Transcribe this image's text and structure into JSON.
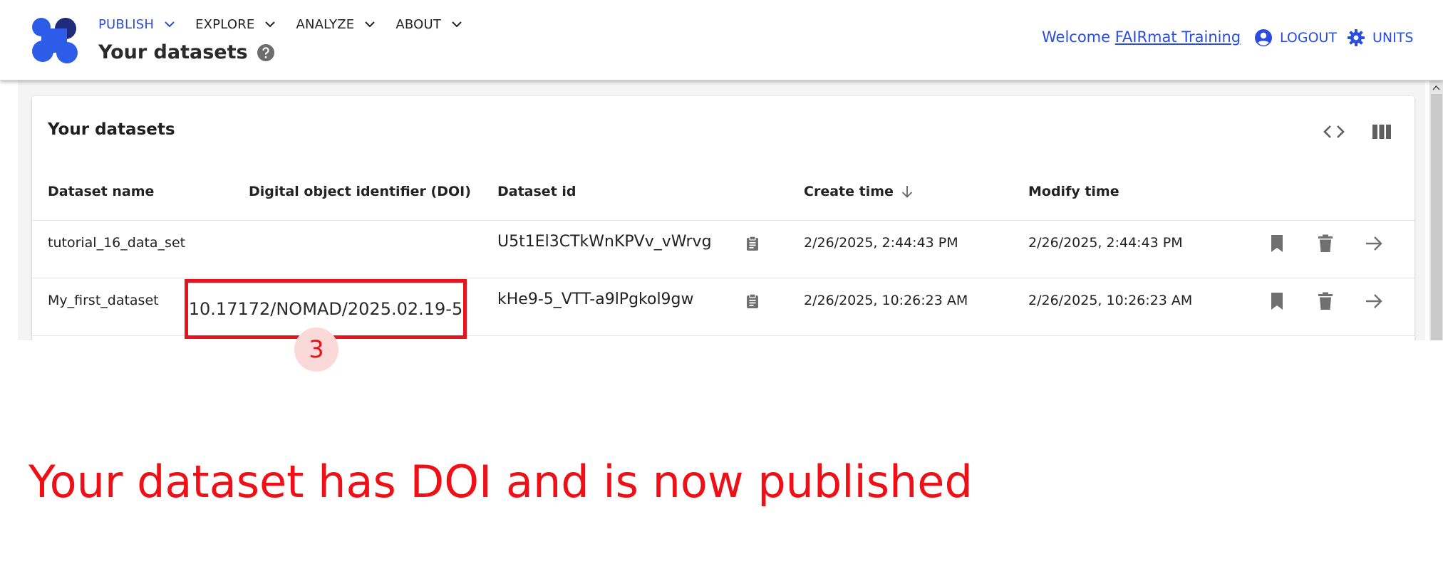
{
  "nav": {
    "items": [
      {
        "label": "PUBLISH",
        "active": true
      },
      {
        "label": "EXPLORE",
        "active": false
      },
      {
        "label": "ANALYZE",
        "active": false
      },
      {
        "label": "ABOUT",
        "active": false
      }
    ],
    "page_title": "Your datasets",
    "welcome_prefix": "Welcome ",
    "user_name": "FAIRmat Training",
    "logout_label": "LOGOUT",
    "units_label": "UNITS"
  },
  "card": {
    "title": "Your datasets"
  },
  "table": {
    "columns": [
      "Dataset name",
      "Digital object identifier (DOI)",
      "Dataset id",
      "Create time",
      "Modify time"
    ],
    "sort_column": "Create time",
    "rows": [
      {
        "name": "tutorial_16_data_set",
        "doi": "",
        "id": "U5t1El3CTkWnKPVv_vWrvg",
        "created": "2/26/2025, 2:44:43 PM",
        "modified": "2/26/2025, 2:44:43 PM"
      },
      {
        "name": "My_first_dataset",
        "doi": "10.17172/NOMAD/2025.02.19-5",
        "id": "kHe9-5_VTT-a9lPgkol9gw",
        "created": "2/26/2025, 10:26:23 AM",
        "modified": "2/26/2025, 10:26:23 AM"
      }
    ]
  },
  "annotation": {
    "step_number": "3",
    "caption": "Your dataset has DOI and is now published"
  },
  "colors": {
    "accent": "#2a4cdf",
    "annotation_red": "#e8141b",
    "icon_gray": "#707070"
  }
}
